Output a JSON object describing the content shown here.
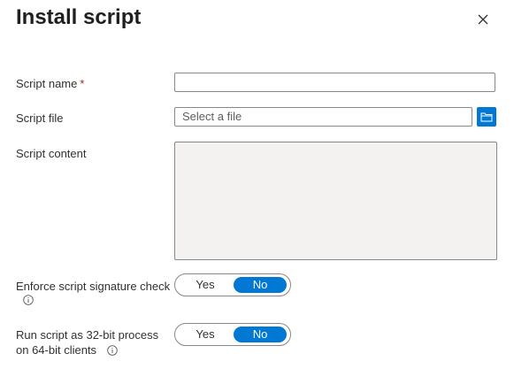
{
  "panel": {
    "title": "Install script",
    "close_icon": "close-icon"
  },
  "fields": {
    "script_name": {
      "label": "Script name",
      "required_marker": "*",
      "value": ""
    },
    "script_file": {
      "label": "Script file",
      "placeholder": "Select a file",
      "browse_icon": "folder-icon"
    },
    "script_content": {
      "label": "Script content",
      "value": ""
    },
    "enforce_signature": {
      "label": "Enforce script signature check",
      "info_icon": "info-icon",
      "options": [
        "Yes",
        "No"
      ],
      "selected": "No"
    },
    "run_32bit": {
      "label_line1": "Run script as 32-bit process",
      "label_line2": "on 64-bit clients",
      "info_icon": "info-icon",
      "options": [
        "Yes",
        "No"
      ],
      "selected": "No"
    }
  },
  "colors": {
    "accent": "#0078d4",
    "required": "#a4262c",
    "text": "#323130",
    "disabled_bg": "#f3f2f1"
  }
}
